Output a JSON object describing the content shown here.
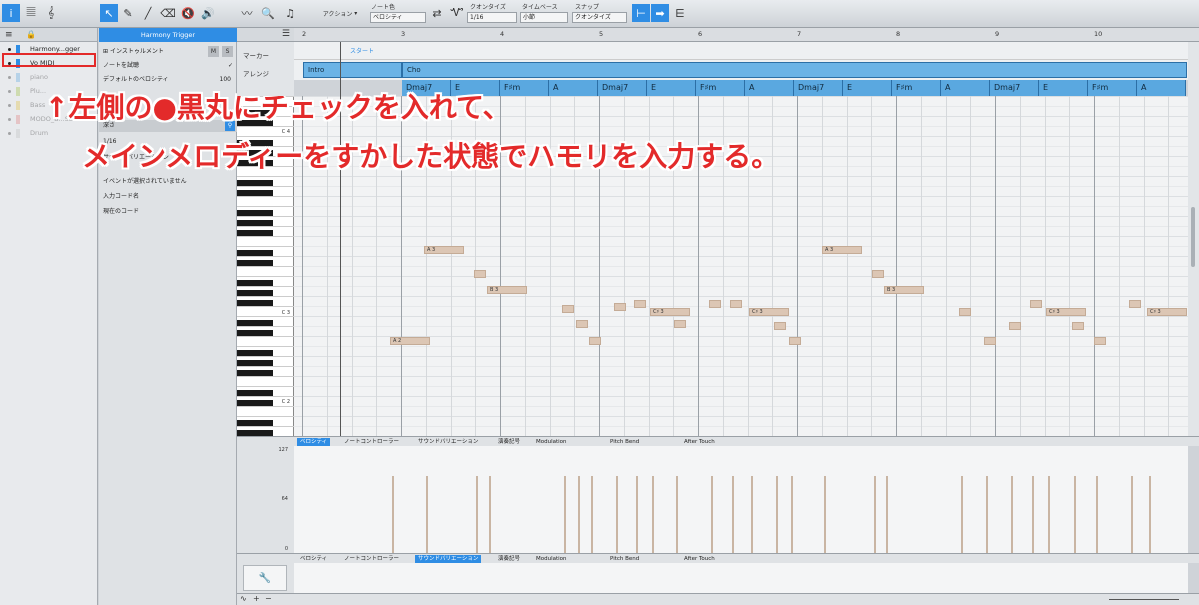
{
  "toolbar": {
    "action_label": "アクション",
    "note_color_label": "ノート色",
    "note_color_value": "ベロシティ",
    "quantize_label": "クオンタイズ",
    "quantize_value": "1/16",
    "timebase_label": "タイムベース",
    "timebase_value": "小節",
    "snap_label": "スナップ",
    "snap_value": "クオンタイズ"
  },
  "tracks": [
    {
      "name": "Harmony...gger",
      "color": "#2f8de4",
      "faded": false
    },
    {
      "name": "Vo MIDI",
      "color": "#2f8de4",
      "faded": false
    },
    {
      "name": "piano",
      "color": "#5aa8e0",
      "faded": true
    },
    {
      "name": "Plu...",
      "color": "#a0c040",
      "faded": true
    },
    {
      "name": "Bass",
      "color": "#e0c040",
      "faded": true
    },
    {
      "name": "MODO_B...SE",
      "color": "#e08080",
      "faded": true
    },
    {
      "name": "Drum",
      "color": "#c0c0c0",
      "faded": true
    }
  ],
  "inspector": {
    "title": "Harmony Trigger",
    "instrument": "インストゥルメント",
    "m": "M",
    "s": "S",
    "trial": "ノートを試聴",
    "default_vel": "デフォルトのベロシティ",
    "default_vel_value": "100",
    "depth": "深さ",
    "ratio": "1/16",
    "variation": "サウンドバリエーション",
    "no_event": "イベントが選択されていません",
    "input_chord": "入力コード名",
    "current_chord": "現在のコード"
  },
  "ruler": {
    "bars": [
      "2",
      "3",
      "4",
      "5",
      "6",
      "7",
      "8",
      "9",
      "10"
    ]
  },
  "lanes": {
    "marker": "マーカー",
    "arrange": "アレンジ",
    "start_marker": "スタート"
  },
  "arrange_sections": [
    "Intro",
    "Cho"
  ],
  "chords": [
    "Dmaj7",
    "E",
    "F♯m",
    "A",
    "Dmaj7",
    "E",
    "F♯m",
    "A",
    "Dmaj7",
    "E",
    "F♯m",
    "A",
    "Dmaj7",
    "E",
    "F♯m",
    "A"
  ],
  "piano_labels": [
    "C 4",
    "C 3",
    "C 2"
  ],
  "note_labels": [
    "A 3",
    "B 3",
    "C♯ 3",
    "A 2"
  ],
  "velocity": {
    "max": "127",
    "mid": "64",
    "min": "0"
  },
  "tabs": [
    "ベロシティ",
    "ノートコントローラー",
    "サウンドバリエーション",
    "演奏記号",
    "Modulation",
    "Pitch Bend",
    "After Touch"
  ],
  "annotation": {
    "line1": "↑左側の●黒丸にチェックを入れて、",
    "line2": "メインメロディーをすかした状態でハモリを入力する。"
  },
  "colors": {
    "accent": "#2f8de4",
    "chord_bg": "#5aa8e0",
    "annotation": "#e32a2a",
    "note": "#dcc6b4"
  }
}
